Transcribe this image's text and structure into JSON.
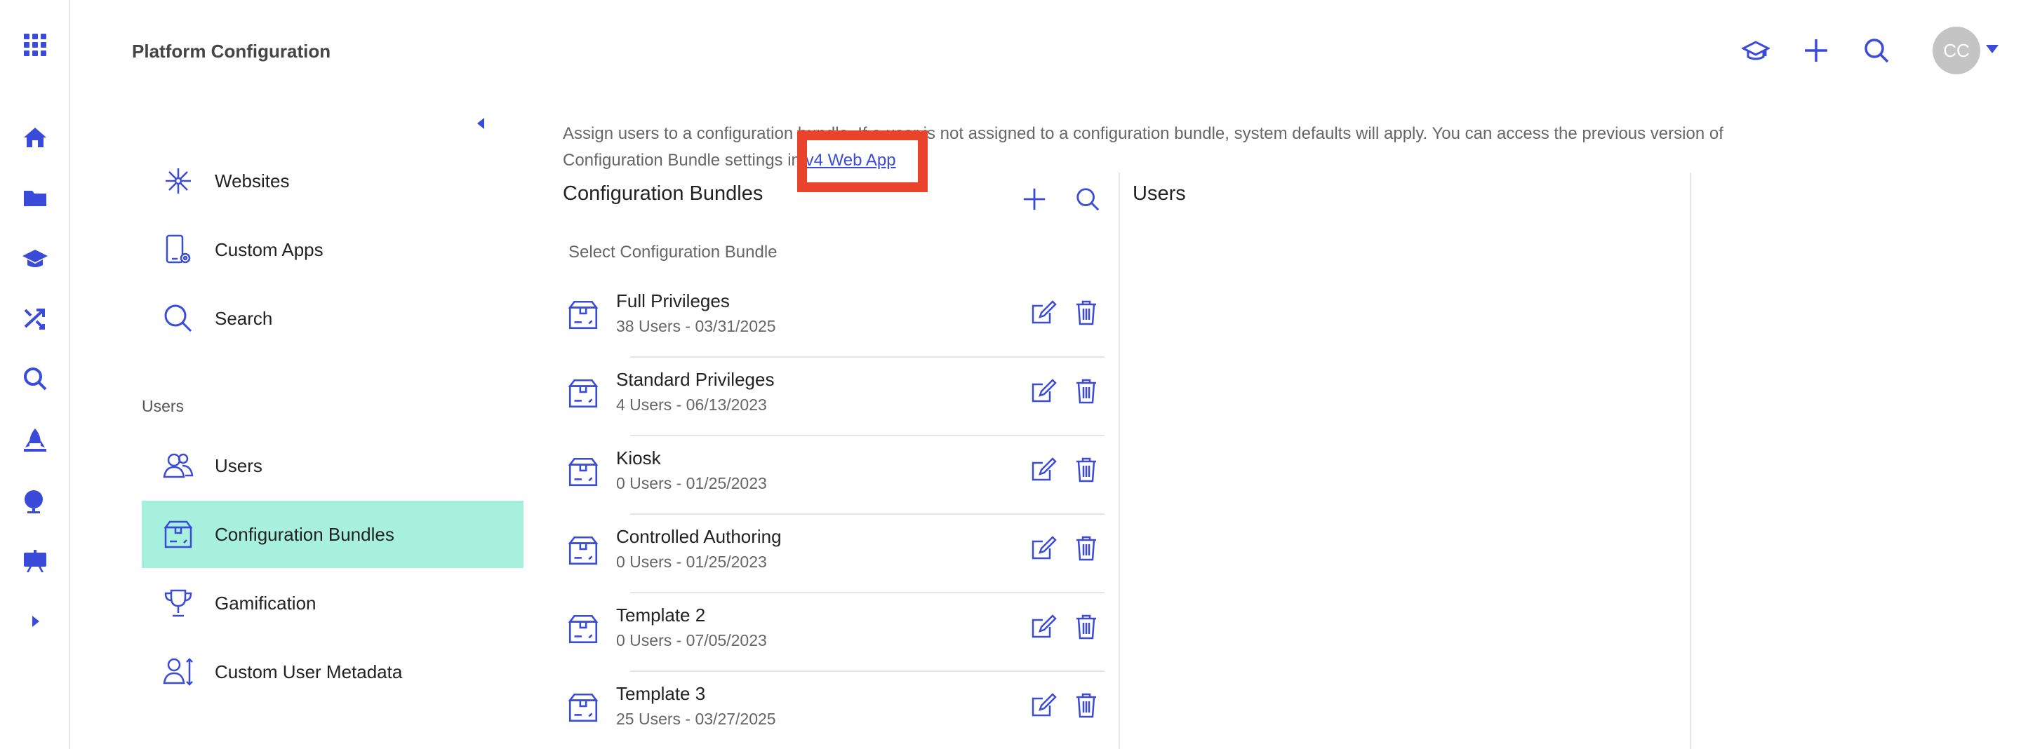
{
  "colors": {
    "accent": "#3a4bd9",
    "active_nav": "#a7f0dd",
    "highlight": "#e9432b"
  },
  "header": {
    "title": "Platform Configuration",
    "avatar_initials": "CC",
    "icons": [
      "graduation-cap-icon",
      "plus-icon",
      "search-icon",
      "chevron-down-icon"
    ]
  },
  "rail": {
    "items": [
      "apps-grid-icon",
      "home-icon",
      "folder-icon",
      "graduation-cap-icon",
      "shuffle-icon",
      "search-icon",
      "rocket-icon",
      "globe-icon",
      "presentation-icon",
      "expand-arrow-icon"
    ]
  },
  "leftnav": {
    "items_top": [
      {
        "label": "Websites",
        "icon": "sparkle-icon"
      },
      {
        "label": "Custom Apps",
        "icon": "tablet-gear-icon"
      },
      {
        "label": "Search",
        "icon": "search-icon"
      }
    ],
    "section_users": "Users",
    "items_users": [
      {
        "label": "Users",
        "icon": "users-icon"
      },
      {
        "label": "Configuration Bundles",
        "icon": "box-icon",
        "active": true
      },
      {
        "label": "Gamification",
        "icon": "trophy-icon"
      },
      {
        "label": "Custom User Metadata",
        "icon": "user-metadata-icon"
      }
    ]
  },
  "intro": {
    "text_before": "Assign users to a configuration bundle. If a user is not assigned to a configuration bundle, system defaults will apply. You can access the previous version of Configuration Bundle settings in ",
    "link": "v4 Web App"
  },
  "bundles_panel": {
    "title": "Configuration Bundles",
    "select_label": "Select Configuration Bundle",
    "bundles": [
      {
        "name": "Full Privileges",
        "meta": "38 Users - 03/31/2025"
      },
      {
        "name": "Standard Privileges",
        "meta": "4 Users - 06/13/2023"
      },
      {
        "name": "Kiosk",
        "meta": "0 Users - 01/25/2023"
      },
      {
        "name": "Controlled Authoring",
        "meta": "0 Users - 01/25/2023"
      },
      {
        "name": "Template 2",
        "meta": "0 Users - 07/05/2023"
      },
      {
        "name": "Template 3",
        "meta": "25 Users - 03/27/2025"
      }
    ]
  },
  "users_panel": {
    "title": "Users"
  }
}
